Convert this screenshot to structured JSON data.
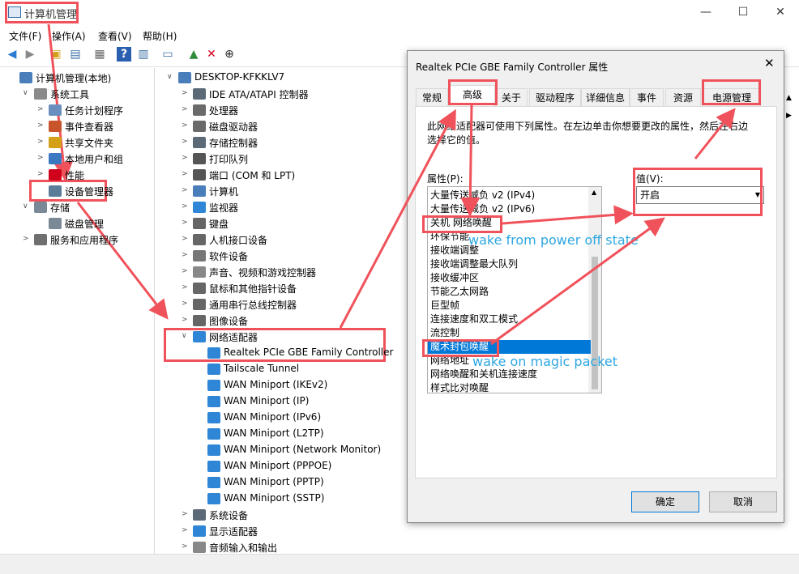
{
  "window": {
    "title": "计算机管理",
    "controls": [
      "—",
      "☐",
      "✕"
    ]
  },
  "menu": [
    "文件(F)",
    "操作(A)",
    "查看(V)",
    "帮助(H)"
  ],
  "toolbar_icons": [
    "back-arrow-icon",
    "forward-arrow-icon",
    "up-folder-icon",
    "show-tree-icon",
    "properties-icon",
    "help-icon",
    "show-action-pane-icon",
    "monitor-icon",
    "enable-device-icon",
    "remove-device-icon",
    "update-driver-icon"
  ],
  "left_tree": [
    {
      "label": "计算机管理(本地)",
      "level": 0,
      "expander": "",
      "icon": "computer-management-icon"
    },
    {
      "label": "系统工具",
      "level": 1,
      "expander": "v",
      "icon": "tools-icon"
    },
    {
      "label": "任务计划程序",
      "level": 2,
      "expander": ">",
      "icon": "clock-icon"
    },
    {
      "label": "事件查看器",
      "level": 2,
      "expander": ">",
      "icon": "event-viewer-icon"
    },
    {
      "label": "共享文件夹",
      "level": 2,
      "expander": ">",
      "icon": "shared-folder-icon"
    },
    {
      "label": "本地用户和组",
      "level": 2,
      "expander": ">",
      "icon": "users-icon"
    },
    {
      "label": "性能",
      "level": 2,
      "expander": ">",
      "icon": "performance-icon"
    },
    {
      "label": "设备管理器",
      "level": 2,
      "expander": "",
      "icon": "device-manager-icon"
    },
    {
      "label": "存储",
      "level": 1,
      "expander": "v",
      "icon": "storage-icon"
    },
    {
      "label": "磁盘管理",
      "level": 2,
      "expander": "",
      "icon": "disk-icon"
    },
    {
      "label": "服务和应用程序",
      "level": 1,
      "expander": ">",
      "icon": "services-icon"
    }
  ],
  "device_tree": [
    {
      "label": "DESKTOP-KFKKLV7",
      "level": 0,
      "expander": "v",
      "icon": "computer-icon"
    },
    {
      "label": "IDE ATA/ATAPI 控制器",
      "level": 1,
      "expander": ">",
      "icon": "ide-controller-icon"
    },
    {
      "label": "处理器",
      "level": 1,
      "expander": ">",
      "icon": "processor-icon"
    },
    {
      "label": "磁盘驱动器",
      "level": 1,
      "expander": ">",
      "icon": "disk-drive-icon"
    },
    {
      "label": "存储控制器",
      "level": 1,
      "expander": ">",
      "icon": "storage-controller-icon"
    },
    {
      "label": "打印队列",
      "level": 1,
      "expander": ">",
      "icon": "printer-icon"
    },
    {
      "label": "端口 (COM 和 LPT)",
      "level": 1,
      "expander": ">",
      "icon": "port-icon"
    },
    {
      "label": "计算机",
      "level": 1,
      "expander": ">",
      "icon": "computer-icon"
    },
    {
      "label": "监视器",
      "level": 1,
      "expander": ">",
      "icon": "monitor-icon"
    },
    {
      "label": "键盘",
      "level": 1,
      "expander": ">",
      "icon": "keyboard-icon"
    },
    {
      "label": "人机接口设备",
      "level": 1,
      "expander": ">",
      "icon": "hid-icon"
    },
    {
      "label": "软件设备",
      "level": 1,
      "expander": ">",
      "icon": "software-device-icon"
    },
    {
      "label": "声音、视频和游戏控制器",
      "level": 1,
      "expander": ">",
      "icon": "sound-icon"
    },
    {
      "label": "鼠标和其他指针设备",
      "level": 1,
      "expander": ">",
      "icon": "mouse-icon"
    },
    {
      "label": "通用串行总线控制器",
      "level": 1,
      "expander": ">",
      "icon": "usb-icon"
    },
    {
      "label": "图像设备",
      "level": 1,
      "expander": ">",
      "icon": "camera-icon"
    },
    {
      "label": "网络适配器",
      "level": 1,
      "expander": "v",
      "icon": "network-adapter-icon"
    },
    {
      "label": "Realtek PCIe GBE Family Controller",
      "level": 2,
      "expander": "",
      "icon": "network-adapter-icon"
    },
    {
      "label": "Tailscale Tunnel",
      "level": 2,
      "expander": "",
      "icon": "network-adapter-icon"
    },
    {
      "label": "WAN Miniport (IKEv2)",
      "level": 2,
      "expander": "",
      "icon": "network-adapter-icon"
    },
    {
      "label": "WAN Miniport (IP)",
      "level": 2,
      "expander": "",
      "icon": "network-adapter-icon"
    },
    {
      "label": "WAN Miniport (IPv6)",
      "level": 2,
      "expander": "",
      "icon": "network-adapter-icon"
    },
    {
      "label": "WAN Miniport (L2TP)",
      "level": 2,
      "expander": "",
      "icon": "network-adapter-icon"
    },
    {
      "label": "WAN Miniport (Network Monitor)",
      "level": 2,
      "expander": "",
      "icon": "network-adapter-icon"
    },
    {
      "label": "WAN Miniport (PPPOE)",
      "level": 2,
      "expander": "",
      "icon": "network-adapter-icon"
    },
    {
      "label": "WAN Miniport (PPTP)",
      "level": 2,
      "expander": "",
      "icon": "network-adapter-icon"
    },
    {
      "label": "WAN Miniport (SSTP)",
      "level": 2,
      "expander": "",
      "icon": "network-adapter-icon"
    },
    {
      "label": "系统设备",
      "level": 1,
      "expander": ">",
      "icon": "system-device-icon"
    },
    {
      "label": "显示适配器",
      "level": 1,
      "expander": ">",
      "icon": "display-adapter-icon"
    },
    {
      "label": "音频输入和输出",
      "level": 1,
      "expander": ">",
      "icon": "audio-icon"
    }
  ],
  "dialog": {
    "title": "Realtek PCIe GBE Family Controller 属性",
    "close": "✕",
    "tabs": [
      "常规",
      "高级",
      "关于",
      "驱动程序",
      "详细信息",
      "事件",
      "资源",
      "电源管理"
    ],
    "active_tab": "高级",
    "description": "此网络适配器可使用下列属性。在左边单击你想要更改的属性，然后在右边选择它的值。",
    "property_label": "属性(P):",
    "value_label": "值(V):",
    "properties": [
      "大量传送减负 v2 (IPv4)",
      "大量传送减负 v2 (IPv6)",
      "关机 网络唤醒",
      "环保节能",
      "接收端调整",
      "接收端调整最大队列",
      "接收缓冲区",
      "节能乙太网路",
      "巨型帧",
      "连接速度和双工模式",
      "流控制",
      "魔术封包唤醒",
      "网络地址",
      "网络唤醒和关机连接速度",
      "样式比对唤醒"
    ],
    "selected_property": "魔术封包唤醒",
    "value": "开启",
    "ok": "确定",
    "cancel": "取消"
  },
  "annotations": {
    "wake_power_off": "wake from power off state",
    "wake_magic": "wake on magic packet",
    "color": "#f0525b",
    "text_color": "#2ea7e0"
  },
  "colors": {
    "selection": "#0078d7",
    "accent_red": "#f0525b"
  }
}
